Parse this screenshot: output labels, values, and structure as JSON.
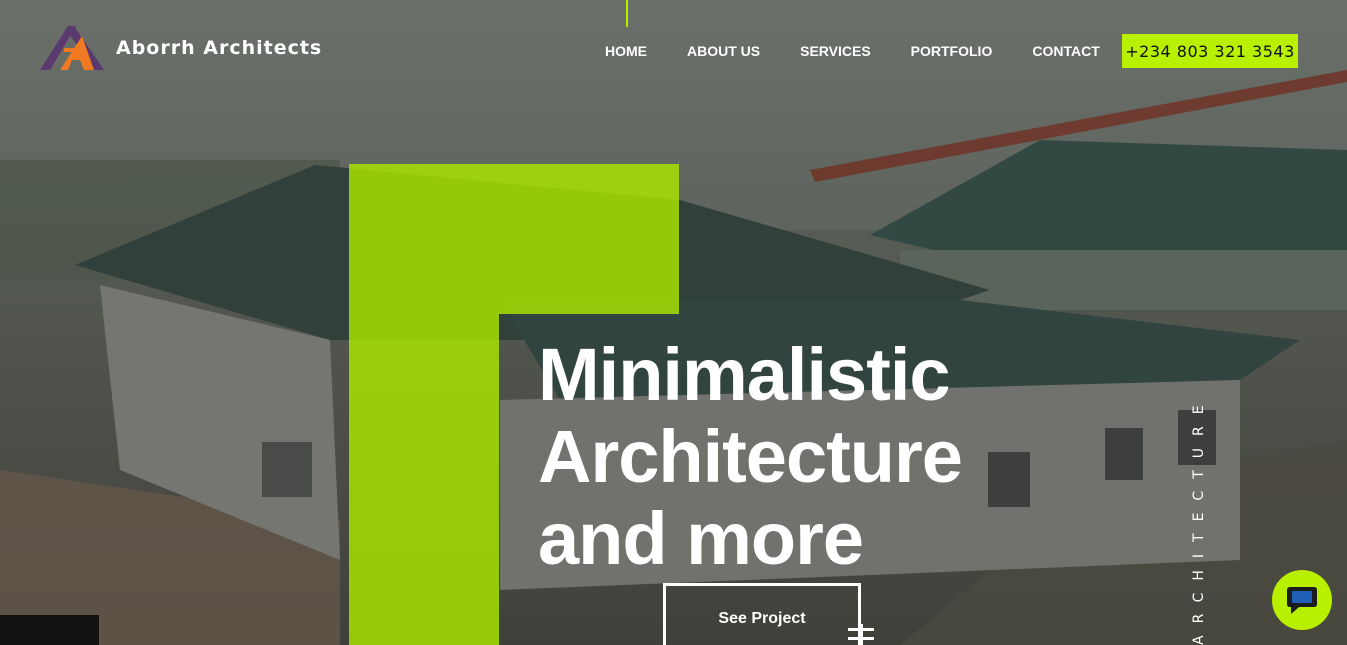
{
  "brand": {
    "name": "Aborrh Architects",
    "logo_icon": "triangle-logo-icon"
  },
  "nav": {
    "items": [
      {
        "label": "HOME"
      },
      {
        "label": "ABOUT US"
      },
      {
        "label": "SERVICES"
      },
      {
        "label": "PORTFOLIO"
      },
      {
        "label": "CONTACT"
      }
    ],
    "phone": "+234 803 321 3543"
  },
  "hero": {
    "headline_lines": [
      "Minimalistic",
      "Architecture",
      "and more"
    ],
    "cta_label": "See Project",
    "vertical_text": "ARCHITECTURE"
  },
  "colors": {
    "accent": "#b8f000",
    "logo_orange": "#f07a22",
    "logo_purple": "#5a3a6e",
    "text": "#ffffff"
  }
}
